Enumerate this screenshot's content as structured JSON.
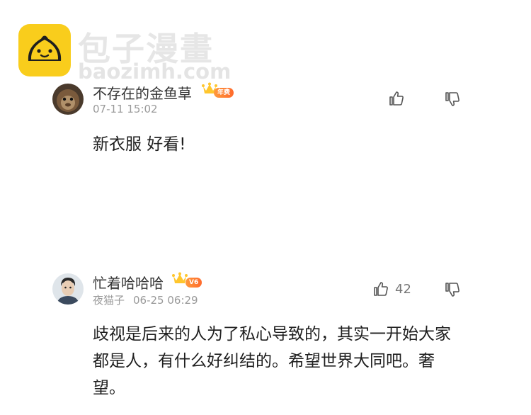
{
  "watermark": {
    "title": "包子漫畫",
    "url": "baozimh.com",
    "logo_color": "#f9cd1c"
  },
  "comments": [
    {
      "username": "不存在的金鱼草",
      "badge": "年费",
      "tag": "",
      "time": "07-11 15:02",
      "text": "新衣服 好看!",
      "like_count": "",
      "avatar_icon": "monkey-avatar"
    },
    {
      "username": "忙着哈哈哈",
      "badge": "V6",
      "tag": "夜猫子",
      "time": "06-25 06:29",
      "text": "歧视是后来的人为了私心导致的，其实一开始大家都是人，有什么好纠结的。希望世界大同吧。奢望。",
      "like_count": "42",
      "avatar_icon": "man-avatar"
    }
  ],
  "colors": {
    "badge_gradient": "#ff8a32",
    "crown": "#ffc62d",
    "meta_text": "#9a9a9a"
  }
}
